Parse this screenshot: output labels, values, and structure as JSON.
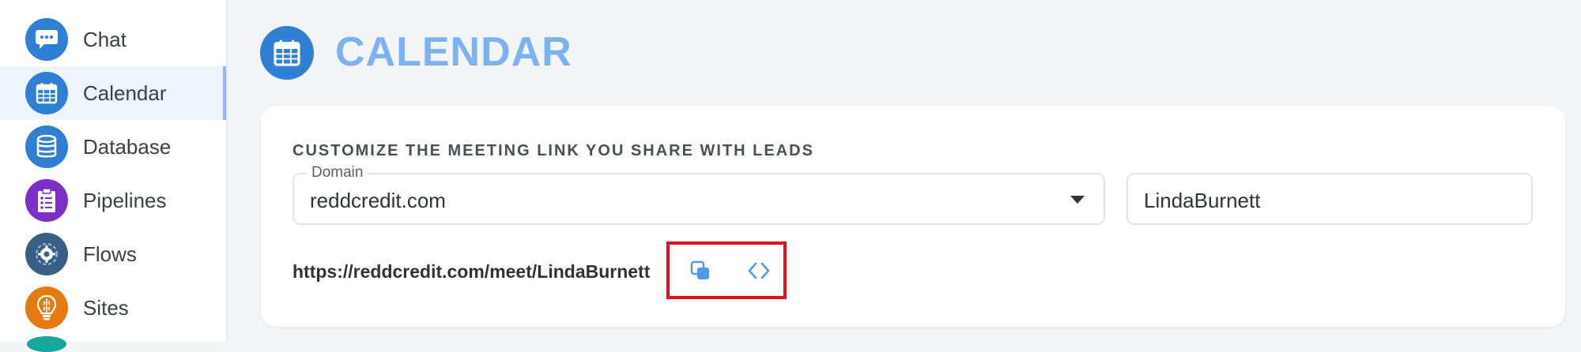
{
  "sidebar": {
    "items": [
      {
        "label": "Chat",
        "icon": "chat-icon",
        "color": "#2f7fd5"
      },
      {
        "label": "Calendar",
        "icon": "calendar-icon",
        "color": "#2f7fd5",
        "active": true
      },
      {
        "label": "Database",
        "icon": "database-icon",
        "color": "#2f7fd5"
      },
      {
        "label": "Pipelines",
        "icon": "clipboard-checklist-icon",
        "color": "#7b2ec8"
      },
      {
        "label": "Flows",
        "icon": "gear-flow-icon",
        "color": "#3a5f86"
      },
      {
        "label": "Sites",
        "icon": "lightbulb-brain-icon",
        "color": "#e57a12"
      }
    ]
  },
  "page": {
    "title": "CALENDAR",
    "icon": "calendar-icon",
    "title_color": "#7cb2f2"
  },
  "card": {
    "heading": "CUSTOMIZE THE MEETING LINK YOU SHARE WITH LEADS",
    "domain_field": {
      "label": "Domain",
      "value": "reddcredit.com"
    },
    "slug_field": {
      "value": "LindaBurnett"
    },
    "meeting_link": "https://reddcredit.com/meet/LindaBurnett",
    "actions": [
      {
        "icon": "copy-icon"
      },
      {
        "icon": "embed-code-icon"
      }
    ],
    "highlight_color": "#e3101a"
  }
}
